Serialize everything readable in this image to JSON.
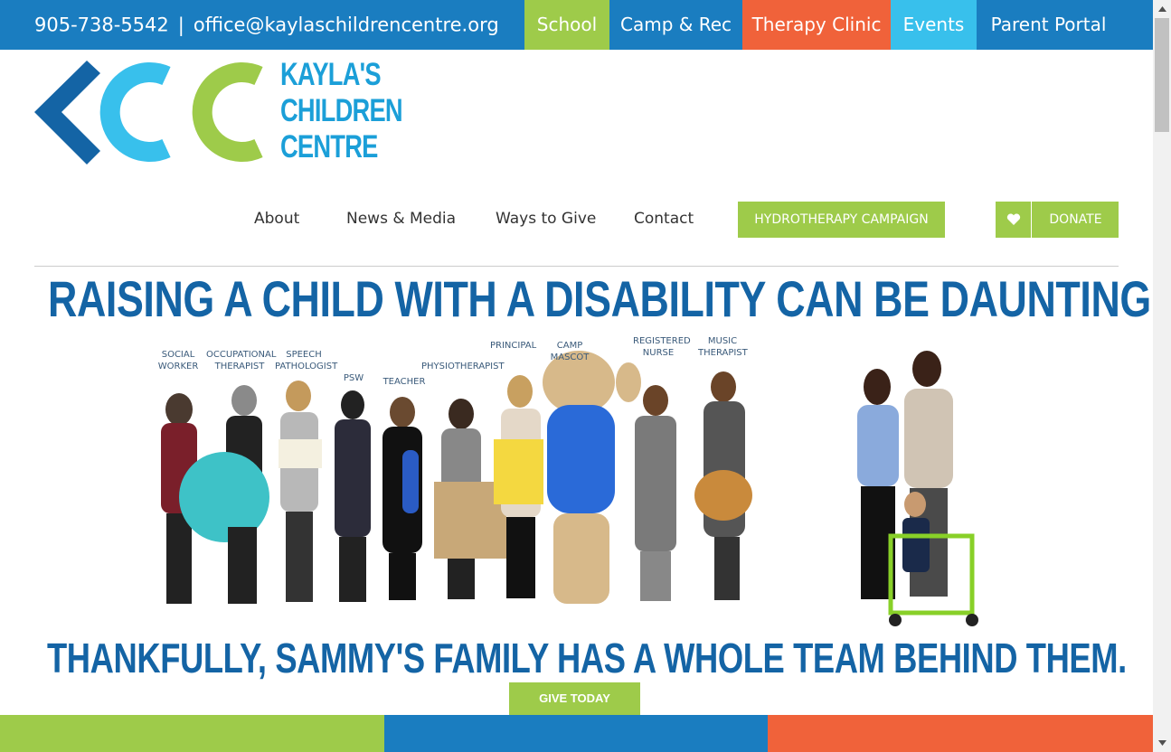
{
  "topbar": {
    "phone": "905-738-5542",
    "separator": "|",
    "email": "office@kaylaschildrencentre.org",
    "tabs": {
      "school": "School",
      "camp": "Camp & Rec",
      "therapy": "Therapy Clinic",
      "events": "Events",
      "portal": "Parent Portal"
    }
  },
  "logo": {
    "line1": "KAYLA'S",
    "line2": "CHILDREN",
    "line3": "CENTRE"
  },
  "nav": {
    "about": "About",
    "news": "News & Media",
    "ways": "Ways to Give",
    "contact": "Contact",
    "hydro": "HYDROTHERAPY CAMPAIGN",
    "donate": "DONATE"
  },
  "hero": {
    "headline": "RAISING A CHILD WITH A DISABILITY CAN BE DAUNTING.",
    "subheadline": "THANKFULLY, SAMMY'S FAMILY HAS A WHOLE TEAM BEHIND THEM.",
    "cta": "GIVE TODAY",
    "captions": {
      "social": "SOCIAL\nWORKER",
      "ot": "OCCUPATIONAL\nTHERAPIST",
      "speech": "SPEECH\nPATHOLOGIST",
      "psw": "PSW",
      "teacher": "TEACHER",
      "physio": "PHYSIOTHERAPIST",
      "principal": "PRINCIPAL",
      "mascot": "CAMP MASCOT",
      "nurse": "REGISTERED\nNURSE",
      "music": "MUSIC\nTHERAPIST"
    }
  },
  "colors": {
    "blue": "#1a7dc0",
    "green": "#9ecb4a",
    "orange": "#f0623a",
    "cyan": "#38c0ec",
    "headline": "#1464a5"
  }
}
